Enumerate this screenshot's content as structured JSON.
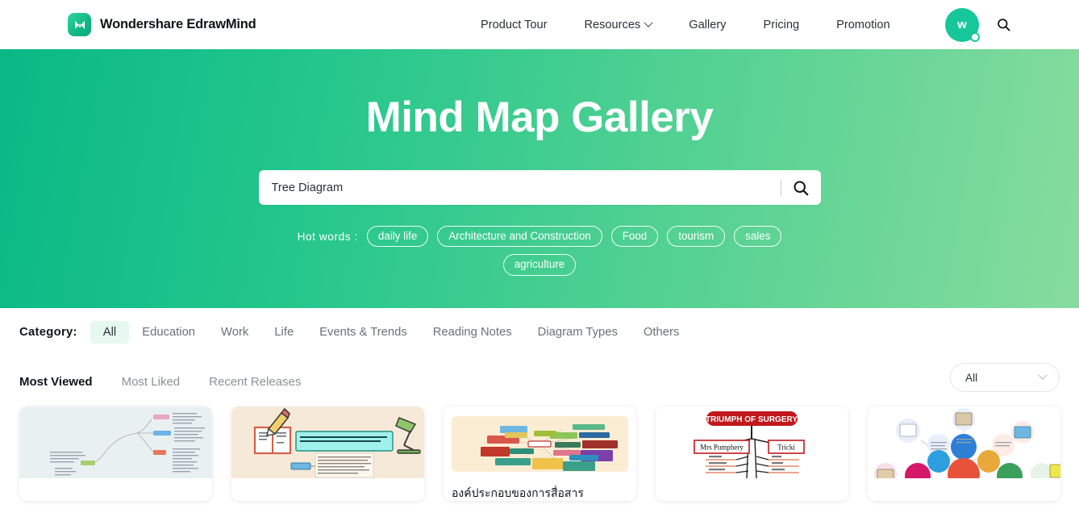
{
  "header": {
    "brand": {
      "name": "Wondershare EdrawMind",
      "logo_icon": "edrawmind-logo-icon"
    },
    "nav": [
      {
        "label": "Product Tour",
        "has_dropdown": false
      },
      {
        "label": "Resources",
        "has_dropdown": true
      },
      {
        "label": "Gallery",
        "has_dropdown": false
      },
      {
        "label": "Pricing",
        "has_dropdown": false
      },
      {
        "label": "Promotion",
        "has_dropdown": false
      }
    ],
    "avatar": {
      "letter": "w",
      "color": "#16c79a"
    },
    "search_icon": "search-icon"
  },
  "hero": {
    "title": "Mind Map Gallery",
    "gradient_from": "#0ab885",
    "gradient_to": "#86dc9e",
    "search": {
      "value": "Tree Diagram",
      "placeholder": "Tree Diagram",
      "button_icon": "search-icon"
    },
    "hot_words_label": "Hot words :",
    "hot_words": [
      "daily life",
      "Architecture and Construction",
      "Food",
      "tourism",
      "sales",
      "agriculture"
    ]
  },
  "filters": {
    "category_label": "Category:",
    "categories": [
      {
        "label": "All",
        "active": true
      },
      {
        "label": "Education",
        "active": false
      },
      {
        "label": "Work",
        "active": false
      },
      {
        "label": "Life",
        "active": false
      },
      {
        "label": "Events & Trends",
        "active": false
      },
      {
        "label": "Reading Notes",
        "active": false
      },
      {
        "label": "Diagram Types",
        "active": false
      },
      {
        "label": "Others",
        "active": false
      }
    ],
    "active_category_bg": "#e6f8f0",
    "sorts": [
      {
        "label": "Most Viewed",
        "active": true
      },
      {
        "label": "Most Liked",
        "active": false
      },
      {
        "label": "Recent Releases",
        "active": false
      }
    ],
    "select": {
      "value": "All",
      "chevron_icon": "chevron-down-icon"
    }
  },
  "gallery": {
    "cards": [
      {
        "title": "",
        "thumb_kind": "blue-gray-mindmap"
      },
      {
        "title": "",
        "thumb_kind": "beige-education-poster"
      },
      {
        "title": "องค์ประกอบของการสื่อสาร",
        "thumb_kind": "cream-colorful-mindmap"
      },
      {
        "title": "",
        "thumb_kind": "triumph-of-surgery-tree",
        "heading": "TRIUMPH OF SURGERY",
        "left_node": "Mrs Pumphery",
        "right_node": "Tricki"
      },
      {
        "title": "",
        "thumb_kind": "colorful-bubble-mindmap"
      }
    ]
  }
}
